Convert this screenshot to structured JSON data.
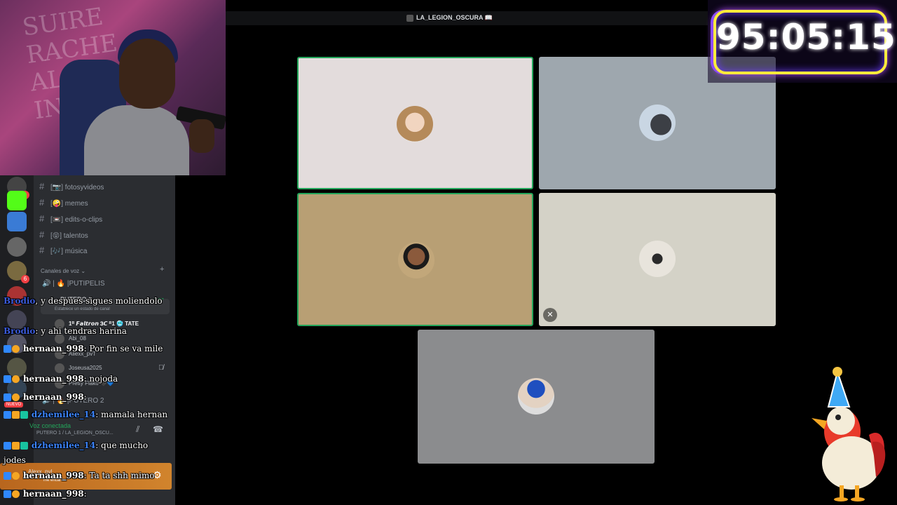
{
  "stream": {
    "timer": "95:05:15"
  },
  "discord": {
    "channel_title": "LA_LEGION_OSCURA",
    "text_channels": [
      {
        "label": "fotosyvideos",
        "prefix": "[📷]"
      },
      {
        "label": "memes",
        "prefix": "[🤪]"
      },
      {
        "label": "edits-o-clips",
        "prefix": "[📼]"
      },
      {
        "label": "talentos",
        "prefix": "[😝]"
      },
      {
        "label": "música",
        "prefix": "[🎶]"
      }
    ],
    "voice_section": "Canales de voz",
    "voice_channels": [
      {
        "label": "PUTIPELIS",
        "prefix": "| 🔥 |"
      },
      {
        "label": "PUTERO 1",
        "prefix": ""
      },
      {
        "label": "PUTERO 2",
        "prefix": "| 🔥 |"
      }
    ],
    "voice_status_hint": "Establece un estado de canal",
    "voice_timer": "2:57",
    "voice_users": [
      "1ᴿ 𝙁𝙖𝙡𝙩𝙧𝙤𝙣 𝟑𝘾 ᴿ1 🥶 TATE",
      "Abi_08",
      "Aliexx_pvT",
      "Joseusa2025",
      "Pretty Flako 🖤💙"
    ],
    "connection_status": "Voz conectada",
    "connection_channel": "PUTERO 1 / LA_LEGION_OSCU...",
    "current_user": "Alexx_pvl",
    "current_user_status": "me encanta",
    "new_badge": "NUEVO"
  },
  "chat": [
    {
      "user": "Brodio",
      "sep": ", ",
      "text": "y despues sigues moliendolo",
      "color": "#3b5bdb"
    },
    {
      "user": "Brodio",
      "sep": ": ",
      "text": "y ahi tendras harina",
      "color": "#3b5bdb"
    },
    {
      "user": "hernaan_998",
      "sep": ": ",
      "text": "Por fin se va mile",
      "color": "#ffffff"
    },
    {
      "user": "hernaan_998",
      "sep": ": ",
      "text": "nojoda",
      "color": "#ffffff"
    },
    {
      "user": "hernaan_998",
      "sep": ": ",
      "text": "",
      "color": "#ffffff"
    },
    {
      "user": "dzhemilee_14",
      "sep": ": ",
      "text": "mamala hernan",
      "color": "#3b82f6"
    },
    {
      "user": "dzhemilee_14",
      "sep": ": ",
      "text": "que mucho jodes",
      "color": "#3b82f6"
    },
    {
      "user": "hernaan_998",
      "sep": ": ",
      "text": "Ta ta shh mimo",
      "color": "#ffffff"
    },
    {
      "user": "hernaan_998",
      "sep": ": ",
      "text": "",
      "color": "#ffffff"
    }
  ],
  "tiles": [
    {
      "bg": "#e3dcdc",
      "speaking": true
    },
    {
      "bg": "#9ea7ae",
      "speaking": false
    },
    {
      "bg": "#b89f74",
      "speaking": true
    },
    {
      "bg": "#d4d2c7",
      "speaking": false,
      "muted": true
    },
    {
      "bg": "#8b8c8e",
      "speaking": false
    }
  ],
  "icons": {
    "mute": "mic-off-icon",
    "settings": "gear-icon",
    "hash": "hash-icon"
  }
}
